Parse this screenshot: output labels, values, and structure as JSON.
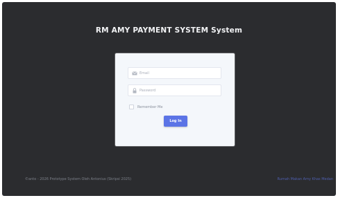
{
  "header": {
    "title": "RM AMY PAYMENT SYSTEM System"
  },
  "login": {
    "email_placeholder": "Email",
    "password_placeholder": "Password",
    "remember_label": "Remember Me",
    "submit_label": "Log In"
  },
  "footer": {
    "copyright": "©anto - 2026 Prototype System Oleh Antonius (Skripsi 2025)",
    "brand_link": "Rumah Makan Amy Khas Medan"
  },
  "colors": {
    "background": "#2b2c2f",
    "card": "#f4f7fb",
    "accent": "#5b74e6",
    "link": "#4f5fae"
  },
  "icons": {
    "email": "envelope-icon",
    "password": "lock-icon"
  }
}
